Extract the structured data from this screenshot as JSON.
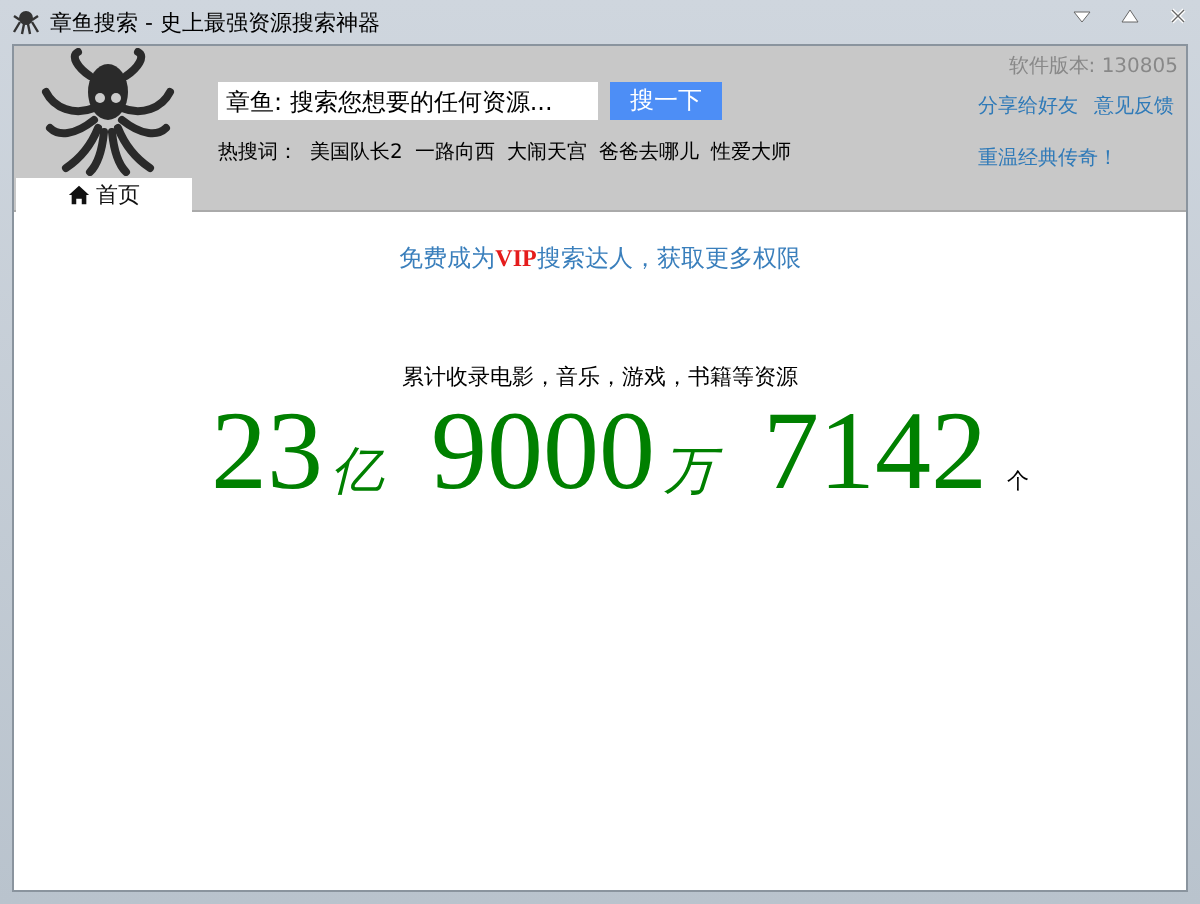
{
  "window": {
    "title": "章鱼搜索 - 史上最强资源搜索神器"
  },
  "version": "软件版本: 130805",
  "search": {
    "placeholder": "章鱼: 搜索您想要的任何资源...",
    "button": "搜一下"
  },
  "hot": {
    "label": "热搜词：",
    "words": [
      "美国队长2",
      "一路向西",
      "大闹天宫",
      "爸爸去哪儿",
      "性爱大师"
    ]
  },
  "links": [
    "分享给好友",
    "意见反馈",
    "重温经典传奇！"
  ],
  "tabs": [
    {
      "label": "首页",
      "selected": true
    }
  ],
  "promo": "免费成为**VIP**搜索达人，获取更多权限",
  "caption": "累计收录电影，音乐，游戏，书籍等资源",
  "counts": [
    {
      "value": "23",
      "unit": "亿",
      "kind": "big"
    },
    {
      "value": "9000",
      "unit": "万",
      "kind": "big"
    },
    {
      "value": "7142",
      "unit": "个",
      "kind": "small"
    }
  ]
}
